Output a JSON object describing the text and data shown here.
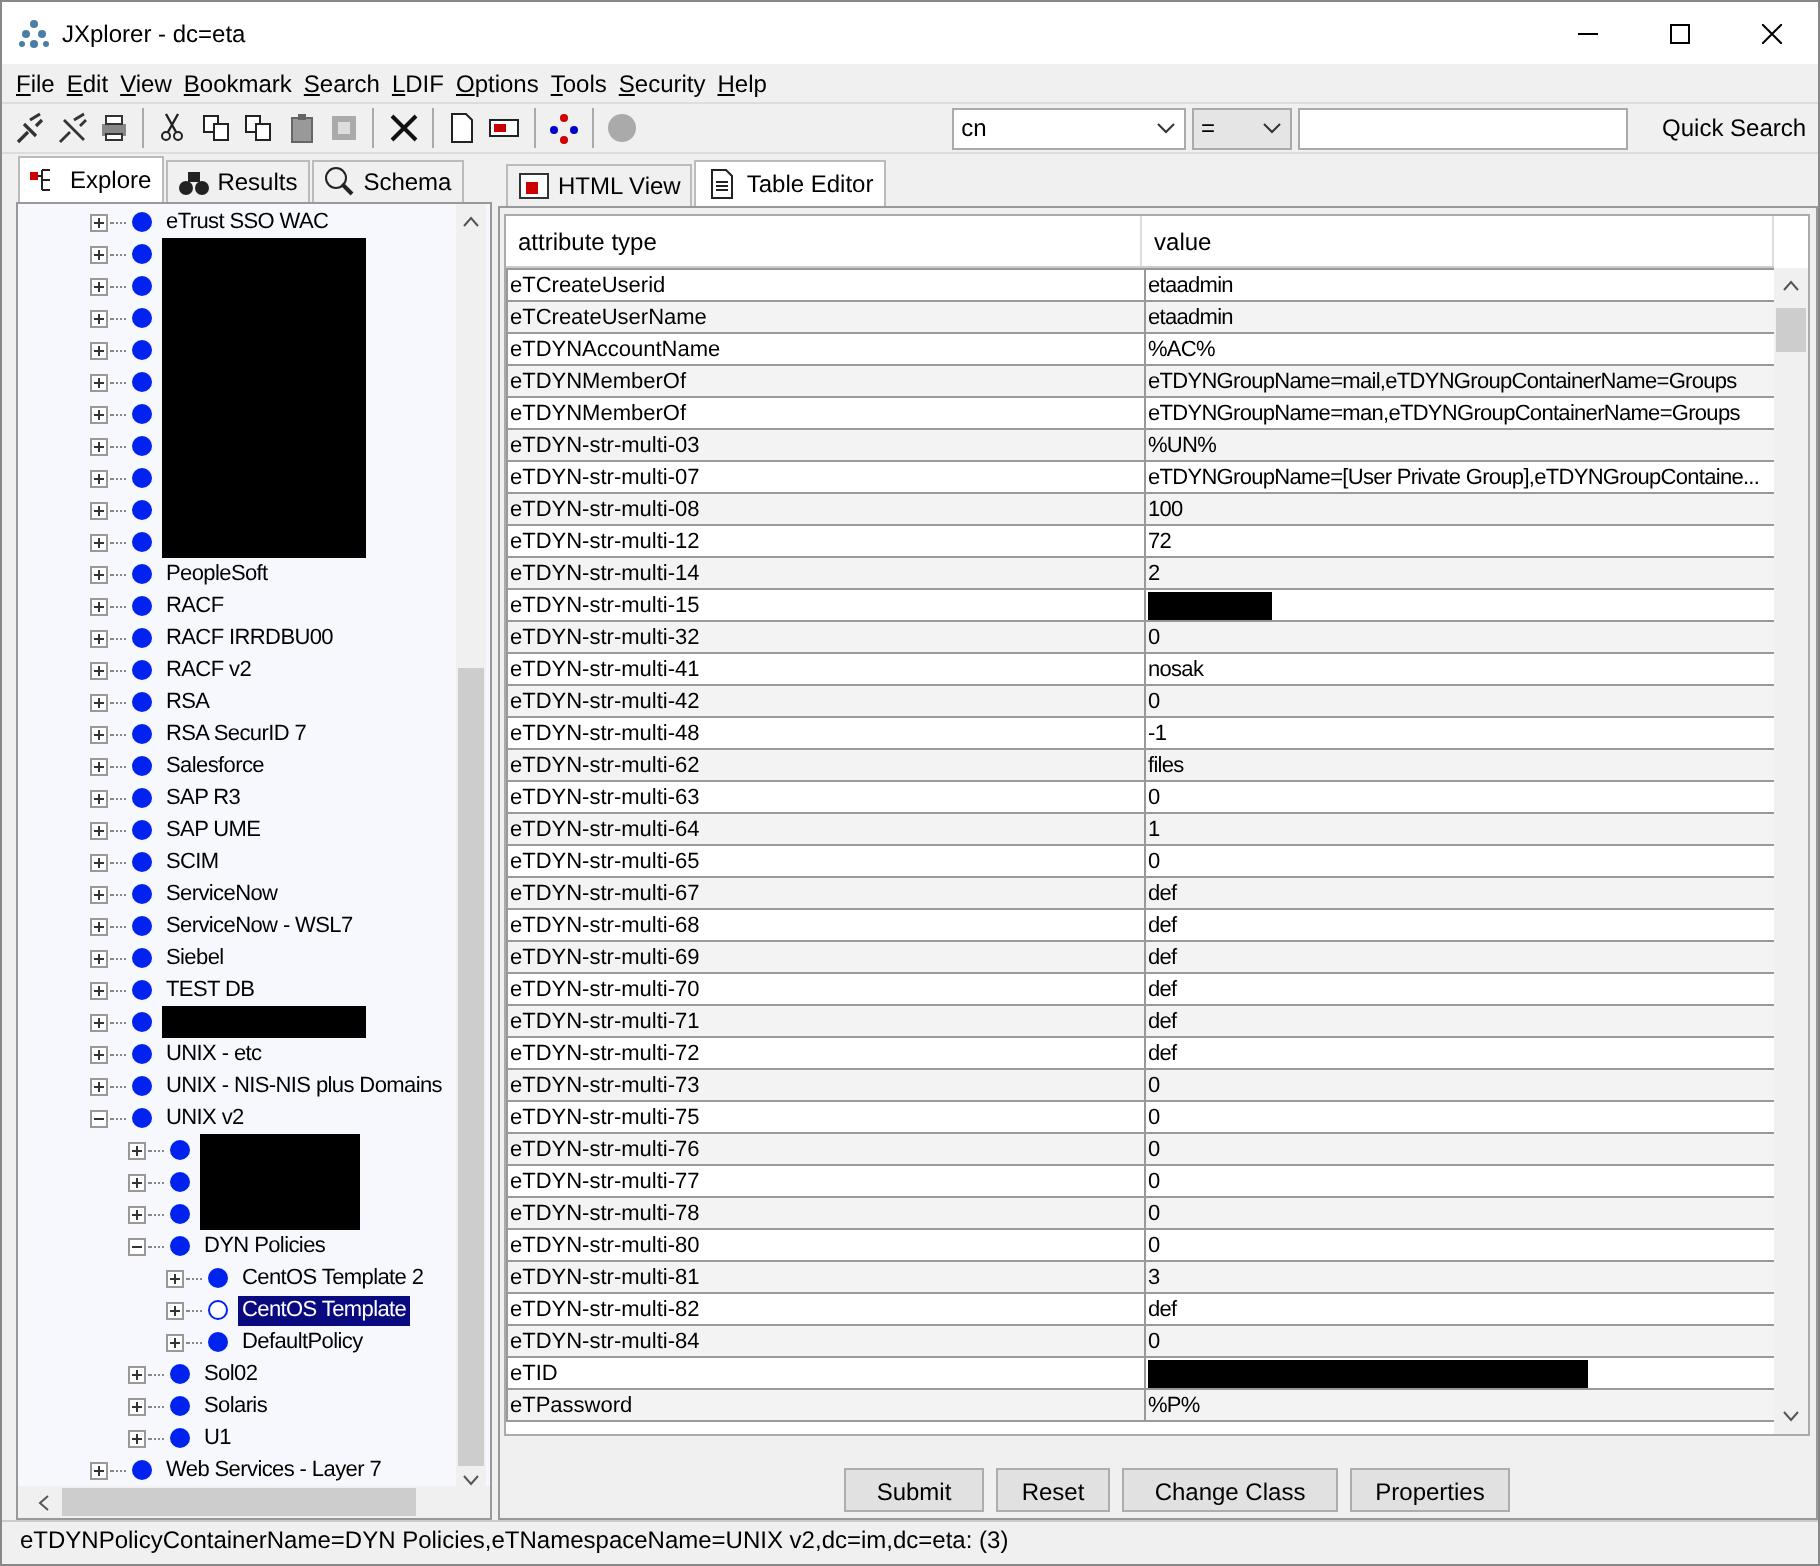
{
  "window": {
    "title": "JXplorer - dc=eta"
  },
  "menu": [
    "File",
    "Edit",
    "View",
    "Bookmark",
    "Search",
    "LDIF",
    "Options",
    "Tools",
    "Security",
    "Help"
  ],
  "quick_search": {
    "attribute": "cn",
    "operator": "=",
    "button": "Quick Search"
  },
  "left_tabs": [
    {
      "label": "Explore",
      "selected": true
    },
    {
      "label": "Results",
      "selected": false
    },
    {
      "label": "Schema",
      "selected": false
    }
  ],
  "tree": [
    {
      "label": "eTrust SSO WAC",
      "expanded": false,
      "selected": false
    },
    {
      "redacted": true,
      "expanded": false,
      "selected": false
    },
    {
      "redacted": true,
      "expanded": false,
      "selected": false
    },
    {
      "redacted": true,
      "expanded": false,
      "selected": false
    },
    {
      "redacted": true,
      "expanded": false,
      "selected": false
    },
    {
      "redacted": true,
      "expanded": false,
      "selected": false
    },
    {
      "redacted": true,
      "expanded": false,
      "selected": false
    },
    {
      "redacted": true,
      "expanded": false,
      "selected": false
    },
    {
      "redacted": true,
      "expanded": false,
      "selected": false
    },
    {
      "redacted": true,
      "expanded": false,
      "selected": false
    },
    {
      "redacted": true,
      "expanded": false,
      "selected": false
    },
    {
      "label": "PeopleSoft",
      "expanded": false,
      "selected": false
    },
    {
      "label": "RACF",
      "expanded": false,
      "selected": false
    },
    {
      "label": "RACF IRRDBU00",
      "expanded": false,
      "selected": false
    },
    {
      "label": "RACF v2",
      "expanded": false,
      "selected": false
    },
    {
      "label": "RSA",
      "expanded": false,
      "selected": false
    },
    {
      "label": "RSA SecurID 7",
      "expanded": false,
      "selected": false
    },
    {
      "label": "Salesforce",
      "expanded": false,
      "selected": false
    },
    {
      "label": "SAP R3",
      "expanded": false,
      "selected": false
    },
    {
      "label": "SAP UME",
      "expanded": false,
      "selected": false
    },
    {
      "label": "SCIM",
      "expanded": false,
      "selected": false
    },
    {
      "label": "ServiceNow",
      "expanded": false,
      "selected": false
    },
    {
      "label": "ServiceNow - WSL7",
      "expanded": false,
      "selected": false
    },
    {
      "label": "Siebel",
      "expanded": false,
      "selected": false
    },
    {
      "label": "TEST DB",
      "expanded": false,
      "selected": false
    },
    {
      "redacted": true,
      "expanded": false,
      "selected": false
    },
    {
      "label": "UNIX - etc",
      "expanded": false,
      "selected": false
    },
    {
      "label": "UNIX - NIS-NIS plus Domains",
      "expanded": false,
      "selected": false
    },
    {
      "label": "UNIX v2",
      "expanded": true,
      "selected": false,
      "children": [
        {
          "redacted": true,
          "expanded": false,
          "selected": false
        },
        {
          "redacted": true,
          "expanded": false,
          "selected": false
        },
        {
          "redacted": true,
          "expanded": false,
          "selected": false
        },
        {
          "label": "DYN Policies",
          "expanded": true,
          "selected": false,
          "children": [
            {
              "label": "CentOS Template 2",
              "expanded": false,
              "selected": false
            },
            {
              "label": "CentOS Template",
              "expanded": false,
              "selected": true
            },
            {
              "label": "DefaultPolicy",
              "expanded": false,
              "selected": false
            }
          ]
        },
        {
          "label": "Sol02",
          "expanded": false,
          "selected": false
        },
        {
          "label": "Solaris",
          "expanded": false,
          "selected": false
        },
        {
          "label": "U1",
          "expanded": false,
          "selected": false
        }
      ]
    },
    {
      "label": "Web Services - Layer 7",
      "expanded": false,
      "selected": false
    }
  ],
  "right_tabs": [
    {
      "label": "HTML View",
      "selected": false
    },
    {
      "label": "Table Editor",
      "selected": true
    }
  ],
  "table": {
    "columns": [
      "attribute type",
      "value"
    ],
    "rows": [
      {
        "attribute": "eTCreateUserid",
        "value": "etaadmin"
      },
      {
        "attribute": "eTCreateUserName",
        "value": "etaadmin"
      },
      {
        "attribute": "eTDYNAccountName",
        "value": "%AC%"
      },
      {
        "attribute": "eTDYNMemberOf",
        "value": "eTDYNGroupName=mail,eTDYNGroupContainerName=Groups"
      },
      {
        "attribute": "eTDYNMemberOf",
        "value": "eTDYNGroupName=man,eTDYNGroupContainerName=Groups"
      },
      {
        "attribute": "eTDYN-str-multi-03",
        "value": "%UN%"
      },
      {
        "attribute": "eTDYN-str-multi-07",
        "value": "eTDYNGroupName=[User Private Group],eTDYNGroupContaine..."
      },
      {
        "attribute": "eTDYN-str-multi-08",
        "value": "100"
      },
      {
        "attribute": "eTDYN-str-multi-12",
        "value": "72"
      },
      {
        "attribute": "eTDYN-str-multi-14",
        "value": "2"
      },
      {
        "attribute": "eTDYN-str-multi-15",
        "redacted": true
      },
      {
        "attribute": "eTDYN-str-multi-32",
        "value": "0"
      },
      {
        "attribute": "eTDYN-str-multi-41",
        "value": "nosak"
      },
      {
        "attribute": "eTDYN-str-multi-42",
        "value": "0"
      },
      {
        "attribute": "eTDYN-str-multi-48",
        "value": "-1"
      },
      {
        "attribute": "eTDYN-str-multi-62",
        "value": "files"
      },
      {
        "attribute": "eTDYN-str-multi-63",
        "value": "0"
      },
      {
        "attribute": "eTDYN-str-multi-64",
        "value": "1"
      },
      {
        "attribute": "eTDYN-str-multi-65",
        "value": "0"
      },
      {
        "attribute": "eTDYN-str-multi-67",
        "value": "def"
      },
      {
        "attribute": "eTDYN-str-multi-68",
        "value": "def"
      },
      {
        "attribute": "eTDYN-str-multi-69",
        "value": "def"
      },
      {
        "attribute": "eTDYN-str-multi-70",
        "value": "def"
      },
      {
        "attribute": "eTDYN-str-multi-71",
        "value": "def"
      },
      {
        "attribute": "eTDYN-str-multi-72",
        "value": "def"
      },
      {
        "attribute": "eTDYN-str-multi-73",
        "value": "0"
      },
      {
        "attribute": "eTDYN-str-multi-75",
        "value": "0"
      },
      {
        "attribute": "eTDYN-str-multi-76",
        "value": "0"
      },
      {
        "attribute": "eTDYN-str-multi-77",
        "value": "0"
      },
      {
        "attribute": "eTDYN-str-multi-78",
        "value": "0"
      },
      {
        "attribute": "eTDYN-str-multi-80",
        "value": "0"
      },
      {
        "attribute": "eTDYN-str-multi-81",
        "value": "3"
      },
      {
        "attribute": "eTDYN-str-multi-82",
        "value": "def"
      },
      {
        "attribute": "eTDYN-str-multi-84",
        "value": "0"
      },
      {
        "attribute": "eTID",
        "redacted": true,
        "wide": true
      },
      {
        "attribute": "eTPassword",
        "value": "%P%"
      }
    ]
  },
  "buttons": [
    "Submit",
    "Reset",
    "Change Class",
    "Properties"
  ],
  "status_bar": "eTDYNPolicyContainerName=DYN Policies,eTNamespaceName=UNIX v2,dc=im,dc=eta: (3)"
}
